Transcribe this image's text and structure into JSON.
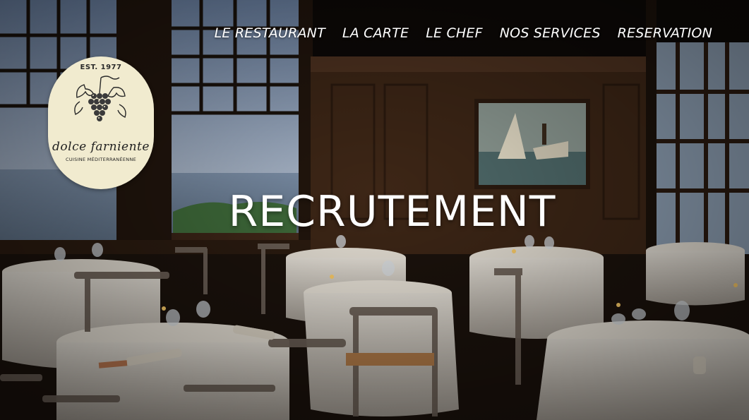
{
  "nav": {
    "items": [
      {
        "label": "LE RESTAURANT"
      },
      {
        "label": "LA CARTE"
      },
      {
        "label": "LE CHEF"
      },
      {
        "label": "NOS SERVICES"
      },
      {
        "label": "RESERVATION"
      }
    ]
  },
  "logo": {
    "est": "EST. 1977",
    "brand": "dolce farniente",
    "tagline": "CUISINE MÉDITERRANÉENNE"
  },
  "hero": {
    "headline": "RECRUTEMENT",
    "image_subject": "restaurant dining room with sea view"
  }
}
